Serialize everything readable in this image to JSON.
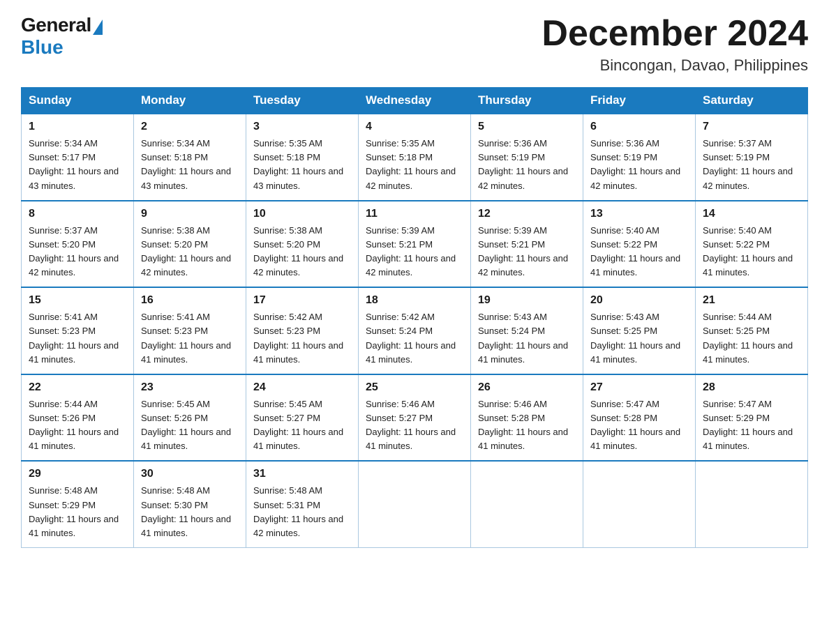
{
  "header": {
    "logo": {
      "general": "General",
      "blue": "Blue"
    },
    "title": "December 2024",
    "location": "Bincongan, Davao, Philippines"
  },
  "calendar": {
    "days": [
      "Sunday",
      "Monday",
      "Tuesday",
      "Wednesday",
      "Thursday",
      "Friday",
      "Saturday"
    ],
    "weeks": [
      [
        {
          "date": "1",
          "sunrise": "5:34 AM",
          "sunset": "5:17 PM",
          "daylight": "11 hours and 43 minutes."
        },
        {
          "date": "2",
          "sunrise": "5:34 AM",
          "sunset": "5:18 PM",
          "daylight": "11 hours and 43 minutes."
        },
        {
          "date": "3",
          "sunrise": "5:35 AM",
          "sunset": "5:18 PM",
          "daylight": "11 hours and 43 minutes."
        },
        {
          "date": "4",
          "sunrise": "5:35 AM",
          "sunset": "5:18 PM",
          "daylight": "11 hours and 42 minutes."
        },
        {
          "date": "5",
          "sunrise": "5:36 AM",
          "sunset": "5:19 PM",
          "daylight": "11 hours and 42 minutes."
        },
        {
          "date": "6",
          "sunrise": "5:36 AM",
          "sunset": "5:19 PM",
          "daylight": "11 hours and 42 minutes."
        },
        {
          "date": "7",
          "sunrise": "5:37 AM",
          "sunset": "5:19 PM",
          "daylight": "11 hours and 42 minutes."
        }
      ],
      [
        {
          "date": "8",
          "sunrise": "5:37 AM",
          "sunset": "5:20 PM",
          "daylight": "11 hours and 42 minutes."
        },
        {
          "date": "9",
          "sunrise": "5:38 AM",
          "sunset": "5:20 PM",
          "daylight": "11 hours and 42 minutes."
        },
        {
          "date": "10",
          "sunrise": "5:38 AM",
          "sunset": "5:20 PM",
          "daylight": "11 hours and 42 minutes."
        },
        {
          "date": "11",
          "sunrise": "5:39 AM",
          "sunset": "5:21 PM",
          "daylight": "11 hours and 42 minutes."
        },
        {
          "date": "12",
          "sunrise": "5:39 AM",
          "sunset": "5:21 PM",
          "daylight": "11 hours and 42 minutes."
        },
        {
          "date": "13",
          "sunrise": "5:40 AM",
          "sunset": "5:22 PM",
          "daylight": "11 hours and 41 minutes."
        },
        {
          "date": "14",
          "sunrise": "5:40 AM",
          "sunset": "5:22 PM",
          "daylight": "11 hours and 41 minutes."
        }
      ],
      [
        {
          "date": "15",
          "sunrise": "5:41 AM",
          "sunset": "5:23 PM",
          "daylight": "11 hours and 41 minutes."
        },
        {
          "date": "16",
          "sunrise": "5:41 AM",
          "sunset": "5:23 PM",
          "daylight": "11 hours and 41 minutes."
        },
        {
          "date": "17",
          "sunrise": "5:42 AM",
          "sunset": "5:23 PM",
          "daylight": "11 hours and 41 minutes."
        },
        {
          "date": "18",
          "sunrise": "5:42 AM",
          "sunset": "5:24 PM",
          "daylight": "11 hours and 41 minutes."
        },
        {
          "date": "19",
          "sunrise": "5:43 AM",
          "sunset": "5:24 PM",
          "daylight": "11 hours and 41 minutes."
        },
        {
          "date": "20",
          "sunrise": "5:43 AM",
          "sunset": "5:25 PM",
          "daylight": "11 hours and 41 minutes."
        },
        {
          "date": "21",
          "sunrise": "5:44 AM",
          "sunset": "5:25 PM",
          "daylight": "11 hours and 41 minutes."
        }
      ],
      [
        {
          "date": "22",
          "sunrise": "5:44 AM",
          "sunset": "5:26 PM",
          "daylight": "11 hours and 41 minutes."
        },
        {
          "date": "23",
          "sunrise": "5:45 AM",
          "sunset": "5:26 PM",
          "daylight": "11 hours and 41 minutes."
        },
        {
          "date": "24",
          "sunrise": "5:45 AM",
          "sunset": "5:27 PM",
          "daylight": "11 hours and 41 minutes."
        },
        {
          "date": "25",
          "sunrise": "5:46 AM",
          "sunset": "5:27 PM",
          "daylight": "11 hours and 41 minutes."
        },
        {
          "date": "26",
          "sunrise": "5:46 AM",
          "sunset": "5:28 PM",
          "daylight": "11 hours and 41 minutes."
        },
        {
          "date": "27",
          "sunrise": "5:47 AM",
          "sunset": "5:28 PM",
          "daylight": "11 hours and 41 minutes."
        },
        {
          "date": "28",
          "sunrise": "5:47 AM",
          "sunset": "5:29 PM",
          "daylight": "11 hours and 41 minutes."
        }
      ],
      [
        {
          "date": "29",
          "sunrise": "5:48 AM",
          "sunset": "5:29 PM",
          "daylight": "11 hours and 41 minutes."
        },
        {
          "date": "30",
          "sunrise": "5:48 AM",
          "sunset": "5:30 PM",
          "daylight": "11 hours and 41 minutes."
        },
        {
          "date": "31",
          "sunrise": "5:48 AM",
          "sunset": "5:31 PM",
          "daylight": "11 hours and 42 minutes."
        },
        null,
        null,
        null,
        null
      ]
    ],
    "labels": {
      "sunrise": "Sunrise:",
      "sunset": "Sunset:",
      "daylight": "Daylight:"
    }
  }
}
